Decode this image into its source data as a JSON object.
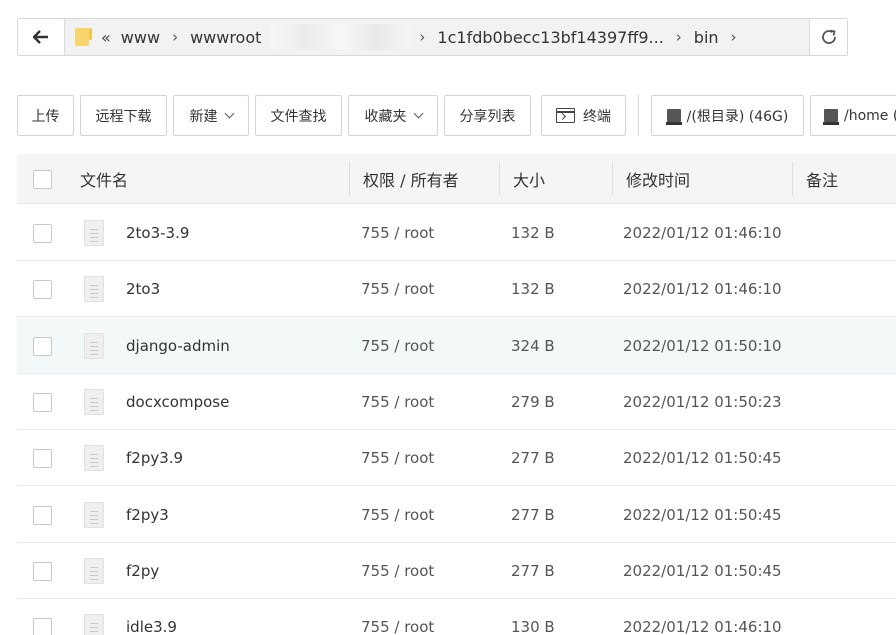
{
  "address_bar": {
    "back_icon": "arrow-left-icon",
    "folder_icon": "folder-icon",
    "overflow_glyph": "«",
    "crumbs": [
      "www",
      "wwwroot",
      "1c1fdb0becc13bf14397ff9...",
      "bin"
    ],
    "separator": "›",
    "refresh_icon": "refresh-icon"
  },
  "toolbar": {
    "upload": "上传",
    "remote_download": "远程下载",
    "new": "新建",
    "file_search": "文件查找",
    "favorites": "收藏夹",
    "share_list": "分享列表",
    "terminal": "终端",
    "disk_root": "/(根目录) (46G)",
    "disk_home": "/home ("
  },
  "table": {
    "headers": {
      "name": "文件名",
      "perm_owner": "权限 / 所有者",
      "size": "大小",
      "mtime": "修改时间",
      "note": "备注"
    },
    "rows": [
      {
        "name": "2to3-3.9",
        "perm": "755 / root",
        "size": "132 B",
        "mtime": "2022/01/12 01:46:10"
      },
      {
        "name": "2to3",
        "perm": "755 / root",
        "size": "132 B",
        "mtime": "2022/01/12 01:46:10"
      },
      {
        "name": "django-admin",
        "perm": "755 / root",
        "size": "324 B",
        "mtime": "2022/01/12 01:50:10"
      },
      {
        "name": "docxcompose",
        "perm": "755 / root",
        "size": "279 B",
        "mtime": "2022/01/12 01:50:23"
      },
      {
        "name": "f2py3.9",
        "perm": "755 / root",
        "size": "277 B",
        "mtime": "2022/01/12 01:50:45"
      },
      {
        "name": "f2py3",
        "perm": "755 / root",
        "size": "277 B",
        "mtime": "2022/01/12 01:50:45"
      },
      {
        "name": "f2py",
        "perm": "755 / root",
        "size": "277 B",
        "mtime": "2022/01/12 01:50:45"
      },
      {
        "name": "idle3.9",
        "perm": "755 / root",
        "size": "130 B",
        "mtime": "2022/01/12 01:46:10"
      }
    ],
    "highlight_color": "#f3f9f8"
  }
}
